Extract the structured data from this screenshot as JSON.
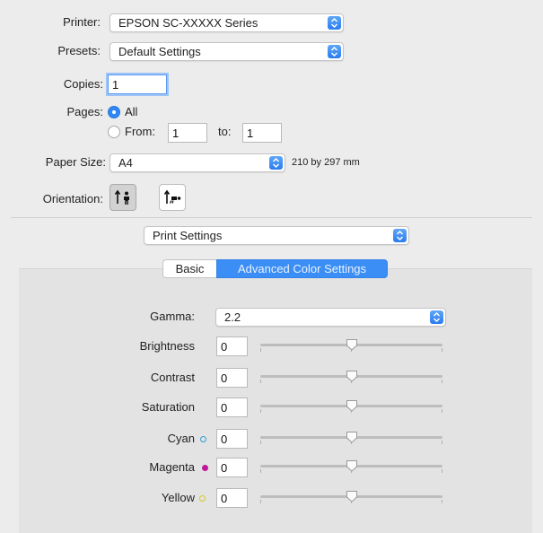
{
  "printer": {
    "label": "Printer:",
    "value": "EPSON SC-XXXXX Series"
  },
  "presets": {
    "label": "Presets:",
    "value": "Default Settings"
  },
  "copies": {
    "label": "Copies:",
    "value": "1"
  },
  "pages": {
    "label": "Pages:",
    "all_label": "All",
    "from_label": "From:",
    "from_value": "1",
    "to_label": "to:",
    "to_value": "1",
    "selected": "all"
  },
  "paper_size": {
    "label": "Paper Size:",
    "value": "A4",
    "dimensions": "210 by 297 mm"
  },
  "orientation": {
    "label": "Orientation:",
    "selected": "portrait",
    "options": [
      "portrait-icon",
      "landscape-icon"
    ]
  },
  "section_popup": {
    "value": "Print Settings"
  },
  "tabs": {
    "basic": "Basic",
    "advanced": "Advanced Color Settings",
    "selected": "advanced"
  },
  "gamma": {
    "label": "Gamma:",
    "value": "2.2"
  },
  "adjustments": [
    {
      "label": "Brightness",
      "value": "0",
      "slider": 0.5
    },
    {
      "label": "Contrast",
      "value": "0",
      "slider": 0.5
    },
    {
      "label": "Saturation",
      "value": "0",
      "slider": 0.5
    },
    {
      "label": "Cyan",
      "value": "0",
      "slider": 0.5,
      "dot_color": "#2f9bd6",
      "dot_style": "hollow"
    },
    {
      "label": "Magenta",
      "value": "0",
      "slider": 0.5,
      "dot_color": "#c0189a",
      "dot_style": "filled"
    },
    {
      "label": "Yellow",
      "value": "0",
      "slider": 0.5,
      "dot_color": "#d6c81e",
      "dot_style": "hollow"
    }
  ],
  "colors": {
    "accent": "#3b8ef5",
    "window_bg": "#ececec",
    "panel_bg": "#e3e3e3"
  }
}
